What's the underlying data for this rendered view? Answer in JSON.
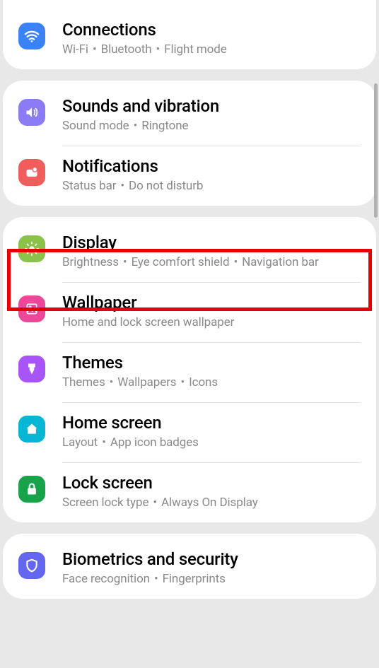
{
  "groups": [
    {
      "items": [
        {
          "id": "connections",
          "icon": "wifi",
          "color": "c-blue",
          "title": "Connections",
          "desc": [
            "Wi-Fi",
            "Bluetooth",
            "Flight mode"
          ]
        }
      ]
    },
    {
      "items": [
        {
          "id": "sounds",
          "icon": "sound",
          "color": "c-purple",
          "title": "Sounds and vibration",
          "desc": [
            "Sound mode",
            "Ringtone"
          ]
        },
        {
          "id": "notifications",
          "icon": "notif",
          "color": "c-red",
          "title": "Notifications",
          "desc": [
            "Status bar",
            "Do not disturb"
          ]
        }
      ]
    },
    {
      "items": [
        {
          "id": "display",
          "icon": "brightness",
          "color": "c-green",
          "title": "Display",
          "desc": [
            "Brightness",
            "Eye comfort shield",
            "Navigation bar"
          ],
          "highlighted": true
        },
        {
          "id": "wallpaper",
          "icon": "wallpaper",
          "color": "c-pink",
          "title": "Wallpaper",
          "desc": [
            "Home and lock screen wallpaper"
          ]
        },
        {
          "id": "themes",
          "icon": "themes",
          "color": "c-violet",
          "title": "Themes",
          "desc": [
            "Themes",
            "Wallpapers",
            "Icons"
          ]
        },
        {
          "id": "homescreen",
          "icon": "home",
          "color": "c-teal",
          "title": "Home screen",
          "desc": [
            "Layout",
            "App icon badges"
          ]
        },
        {
          "id": "lockscreen",
          "icon": "lock",
          "color": "c-darkgreen",
          "title": "Lock screen",
          "desc": [
            "Screen lock type",
            "Always On Display"
          ]
        }
      ]
    },
    {
      "items": [
        {
          "id": "biometrics",
          "icon": "shield",
          "color": "c-indigo",
          "title": "Biometrics and security",
          "desc": [
            "Face recognition",
            "Fingerprints"
          ]
        }
      ]
    }
  ]
}
